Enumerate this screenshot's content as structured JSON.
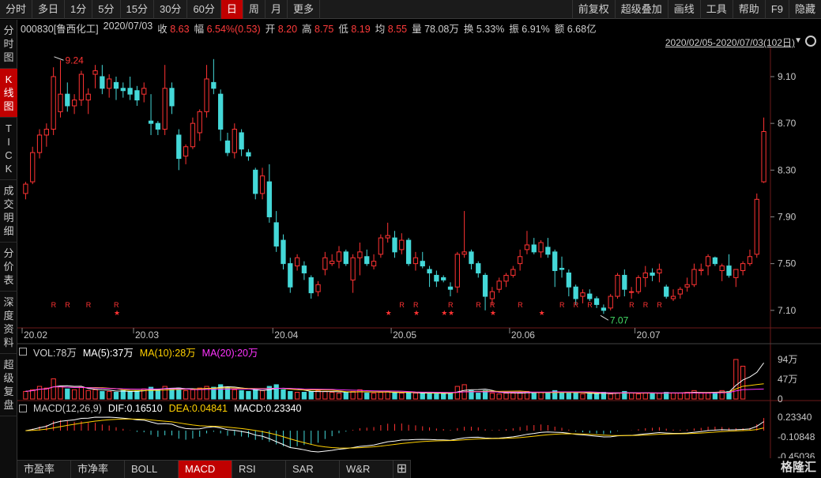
{
  "toolbar": {
    "periods": [
      "分时",
      "多日",
      "1分",
      "5分",
      "15分",
      "30分",
      "60分",
      "日",
      "周",
      "月",
      "更多"
    ],
    "active_period": "日",
    "right_buttons": [
      "前复权",
      "超级叠加",
      "画线",
      "工具",
      "帮助",
      "F9",
      "隐藏"
    ]
  },
  "sidebar": {
    "tabs": [
      "分时图",
      "K线图",
      "TICK",
      "成交明细",
      "分价表",
      "深度资料",
      "超级复盘"
    ],
    "active": "K线图"
  },
  "quote": {
    "code": "000830[鲁西化工]",
    "date": "2020/07/03",
    "close_label": "收",
    "close": "8.63",
    "change_label": "幅",
    "change": "6.54%(0.53)",
    "open_label": "开",
    "open": "8.20",
    "high_label": "高",
    "high": "8.75",
    "low_label": "低",
    "low": "8.19",
    "avg_label": "均",
    "avg": "8.55",
    "vol_label": "量",
    "vol": "78.08万",
    "turnover_label": "换",
    "turnover": "5.33%",
    "amplitude_label": "振",
    "amplitude": "6.91%",
    "amount_label": "额",
    "amount": "6.68亿"
  },
  "range_label": "2020/02/05-2020/07/03(102日)",
  "colors": {
    "up": "#ff3333",
    "down": "#44d8d8",
    "ma5": "#ffffff",
    "ma10": "#ffd000",
    "ma20": "#ff33ff",
    "active": "#c00000"
  },
  "chart_data": {
    "type": "candlestick",
    "y_ticks": [
      "9.10",
      "8.70",
      "8.30",
      "7.90",
      "7.50",
      "7.10"
    ],
    "x_ticks": [
      "20.02",
      "20.03",
      "20.04",
      "20.05",
      "20.06",
      "20.07"
    ],
    "max_label": "9.24",
    "min_label": "7.07",
    "ohlc": [
      [
        8.1,
        8.2,
        8.05,
        8.18
      ],
      [
        8.2,
        8.5,
        8.18,
        8.45
      ],
      [
        8.45,
        8.65,
        8.4,
        8.6
      ],
      [
        8.6,
        8.7,
        8.5,
        8.65
      ],
      [
        8.65,
        9.18,
        8.6,
        9.1
      ],
      [
        8.8,
        9.24,
        8.75,
        8.95
      ],
      [
        8.95,
        9.05,
        8.8,
        8.85
      ],
      [
        8.85,
        8.95,
        8.78,
        8.9
      ],
      [
        8.9,
        9.15,
        8.85,
        9.12
      ],
      [
        8.9,
        9.0,
        8.78,
        8.95
      ],
      [
        9.12,
        9.2,
        9.0,
        9.15
      ],
      [
        9.1,
        9.2,
        8.95,
        9.0
      ],
      [
        9.0,
        9.12,
        8.92,
        9.08
      ],
      [
        9.05,
        9.1,
        8.9,
        9.0
      ],
      [
        9.0,
        9.05,
        8.92,
        8.98
      ],
      [
        9.0,
        9.1,
        8.9,
        8.95
      ],
      [
        8.98,
        9.02,
        8.85,
        8.9
      ],
      [
        8.95,
        9.05,
        8.88,
        9.0
      ],
      [
        8.72,
        8.95,
        8.6,
        8.7
      ],
      [
        8.7,
        8.72,
        8.6,
        8.65
      ],
      [
        8.65,
        9.2,
        8.6,
        9.0
      ],
      [
        9.0,
        9.05,
        8.78,
        8.85
      ],
      [
        8.6,
        8.65,
        8.3,
        8.4
      ],
      [
        8.42,
        8.52,
        8.35,
        8.5
      ],
      [
        8.5,
        8.75,
        8.48,
        8.7
      ],
      [
        8.62,
        8.82,
        8.55,
        8.8
      ],
      [
        8.8,
        9.2,
        8.75,
        9.08
      ],
      [
        9.05,
        9.25,
        8.95,
        9.0
      ],
      [
        8.95,
        8.99,
        8.55,
        8.65
      ],
      [
        8.55,
        8.62,
        8.42,
        8.45
      ],
      [
        8.45,
        8.7,
        8.4,
        8.65
      ],
      [
        8.62,
        8.65,
        8.42,
        8.48
      ],
      [
        8.45,
        8.48,
        8.38,
        8.42
      ],
      [
        8.3,
        8.32,
        8.05,
        8.1
      ],
      [
        8.1,
        8.32,
        8.05,
        8.25
      ],
      [
        8.2,
        8.35,
        7.85,
        7.9
      ],
      [
        7.85,
        7.95,
        7.6,
        7.65
      ],
      [
        7.7,
        7.75,
        7.45,
        7.5
      ],
      [
        7.5,
        7.55,
        7.25,
        7.3
      ],
      [
        7.48,
        7.58,
        7.44,
        7.55
      ],
      [
        7.48,
        7.52,
        7.36,
        7.42
      ],
      [
        7.38,
        7.4,
        7.2,
        7.25
      ],
      [
        7.26,
        7.35,
        7.22,
        7.32
      ],
      [
        7.45,
        7.6,
        7.4,
        7.55
      ],
      [
        7.5,
        7.58,
        7.48,
        7.52
      ],
      [
        7.52,
        7.65,
        7.46,
        7.6
      ],
      [
        7.6,
        7.62,
        7.48,
        7.5
      ],
      [
        7.36,
        7.58,
        7.25,
        7.55
      ],
      [
        7.55,
        7.68,
        7.4,
        7.6
      ],
      [
        7.56,
        7.62,
        7.48,
        7.5
      ],
      [
        7.48,
        7.58,
        7.45,
        7.52
      ],
      [
        7.58,
        7.75,
        7.55,
        7.72
      ],
      [
        7.72,
        7.85,
        7.68,
        7.74
      ],
      [
        7.72,
        7.78,
        7.55,
        7.6
      ],
      [
        7.62,
        7.76,
        7.58,
        7.7
      ],
      [
        7.7,
        7.72,
        7.48,
        7.5
      ],
      [
        7.5,
        7.6,
        7.44,
        7.55
      ],
      [
        7.52,
        7.6,
        7.46,
        7.48
      ],
      [
        7.45,
        7.48,
        7.3,
        7.42
      ],
      [
        7.4,
        7.44,
        7.3,
        7.35
      ],
      [
        7.38,
        7.4,
        7.34,
        7.36
      ],
      [
        7.3,
        7.34,
        7.22,
        7.28
      ],
      [
        7.3,
        7.6,
        7.25,
        7.58
      ],
      [
        7.58,
        7.95,
        7.55,
        7.6
      ],
      [
        7.6,
        7.62,
        7.45,
        7.5
      ],
      [
        7.5,
        7.52,
        7.38,
        7.42
      ],
      [
        7.4,
        7.42,
        7.1,
        7.22
      ],
      [
        7.2,
        7.3,
        7.15,
        7.26
      ],
      [
        7.28,
        7.38,
        7.25,
        7.35
      ],
      [
        7.35,
        7.42,
        7.3,
        7.4
      ],
      [
        7.4,
        7.48,
        7.38,
        7.45
      ],
      [
        7.5,
        7.62,
        7.44,
        7.56
      ],
      [
        7.62,
        7.78,
        7.58,
        7.66
      ],
      [
        7.66,
        7.72,
        7.58,
        7.6
      ],
      [
        7.6,
        7.7,
        7.55,
        7.68
      ],
      [
        7.64,
        7.72,
        7.55,
        7.58
      ],
      [
        7.6,
        7.62,
        7.3,
        7.44
      ],
      [
        7.46,
        7.56,
        7.38,
        7.45
      ],
      [
        7.42,
        7.45,
        7.22,
        7.3
      ],
      [
        7.3,
        7.32,
        7.15,
        7.2
      ],
      [
        7.22,
        7.28,
        7.16,
        7.25
      ],
      [
        7.24,
        7.28,
        7.18,
        7.2
      ],
      [
        7.2,
        7.22,
        7.12,
        7.15
      ],
      [
        7.12,
        7.15,
        7.07,
        7.1
      ],
      [
        7.12,
        7.24,
        7.1,
        7.22
      ],
      [
        7.22,
        7.42,
        7.2,
        7.4
      ],
      [
        7.4,
        7.45,
        7.22,
        7.28
      ],
      [
        7.26,
        7.3,
        7.2,
        7.26
      ],
      [
        7.26,
        7.4,
        7.24,
        7.38
      ],
      [
        7.38,
        7.48,
        7.3,
        7.42
      ],
      [
        7.42,
        7.46,
        7.35,
        7.4
      ],
      [
        7.42,
        7.5,
        7.34,
        7.45
      ],
      [
        7.3,
        7.32,
        7.2,
        7.22
      ],
      [
        7.2,
        7.28,
        7.18,
        7.22
      ],
      [
        7.24,
        7.3,
        7.2,
        7.28
      ],
      [
        7.3,
        7.38,
        7.26,
        7.32
      ],
      [
        7.32,
        7.5,
        7.3,
        7.45
      ],
      [
        7.44,
        7.5,
        7.4,
        7.45
      ],
      [
        7.48,
        7.58,
        7.4,
        7.56
      ],
      [
        7.55,
        7.56,
        7.48,
        7.5
      ],
      [
        7.44,
        7.5,
        7.35,
        7.48
      ],
      [
        7.48,
        7.58,
        7.38,
        7.4
      ],
      [
        7.38,
        7.45,
        7.3,
        7.45
      ],
      [
        7.44,
        7.52,
        7.4,
        7.5
      ],
      [
        7.5,
        7.62,
        7.48,
        7.56
      ],
      [
        7.58,
        8.1,
        7.55,
        8.05
      ],
      [
        8.2,
        8.75,
        8.19,
        8.63
      ]
    ],
    "markers": {
      "R": [
        4,
        6,
        9,
        13,
        54,
        56,
        61,
        65,
        67,
        71,
        77,
        79,
        81,
        87,
        89,
        91
      ],
      "star": [
        13,
        52,
        56,
        60,
        61,
        67,
        74
      ]
    },
    "vol_legend": {
      "vol": "VOL:78万",
      "ma5": "MA(5):37万",
      "ma10": "MA(10):28万",
      "ma20": "MA(20):20万"
    },
    "vol_ticks": [
      "94万",
      "47万",
      "0"
    ],
    "volumes": [
      18,
      22,
      30,
      26,
      48,
      30,
      24,
      22,
      28,
      20,
      22,
      18,
      18,
      16,
      20,
      18,
      20,
      24,
      28,
      22,
      30,
      24,
      26,
      20,
      22,
      26,
      30,
      28,
      34,
      28,
      22,
      20,
      18,
      22,
      20,
      30,
      34,
      22,
      18,
      16,
      16,
      18,
      20,
      18,
      16,
      14,
      16,
      18,
      22,
      14,
      14,
      16,
      18,
      16,
      14,
      14,
      14,
      13,
      16,
      12,
      12,
      14,
      30,
      34,
      20,
      14,
      20,
      14,
      12,
      14,
      14,
      16,
      18,
      14,
      16,
      14,
      20,
      16,
      14,
      14,
      12,
      12,
      14,
      16,
      12,
      14,
      18,
      14,
      12,
      14,
      14,
      14,
      16,
      14,
      14,
      16,
      20,
      14,
      14,
      16,
      20,
      18,
      94,
      78
    ],
    "macd_legend": {
      "name": "MACD(12,26,9)",
      "dif": "DIF:0.16510",
      "dea": "DEA:0.04841",
      "macd": "MACD:0.23340"
    },
    "macd_ticks": [
      "0.23340",
      "-0.10848",
      "-0.45036"
    ]
  },
  "bottom_tabs": [
    "市盈率",
    "市净率",
    "BOLL",
    "MACD",
    "RSI",
    "SAR",
    "W&R"
  ],
  "bottom_active": "MACD",
  "watermark": "格隆汇"
}
